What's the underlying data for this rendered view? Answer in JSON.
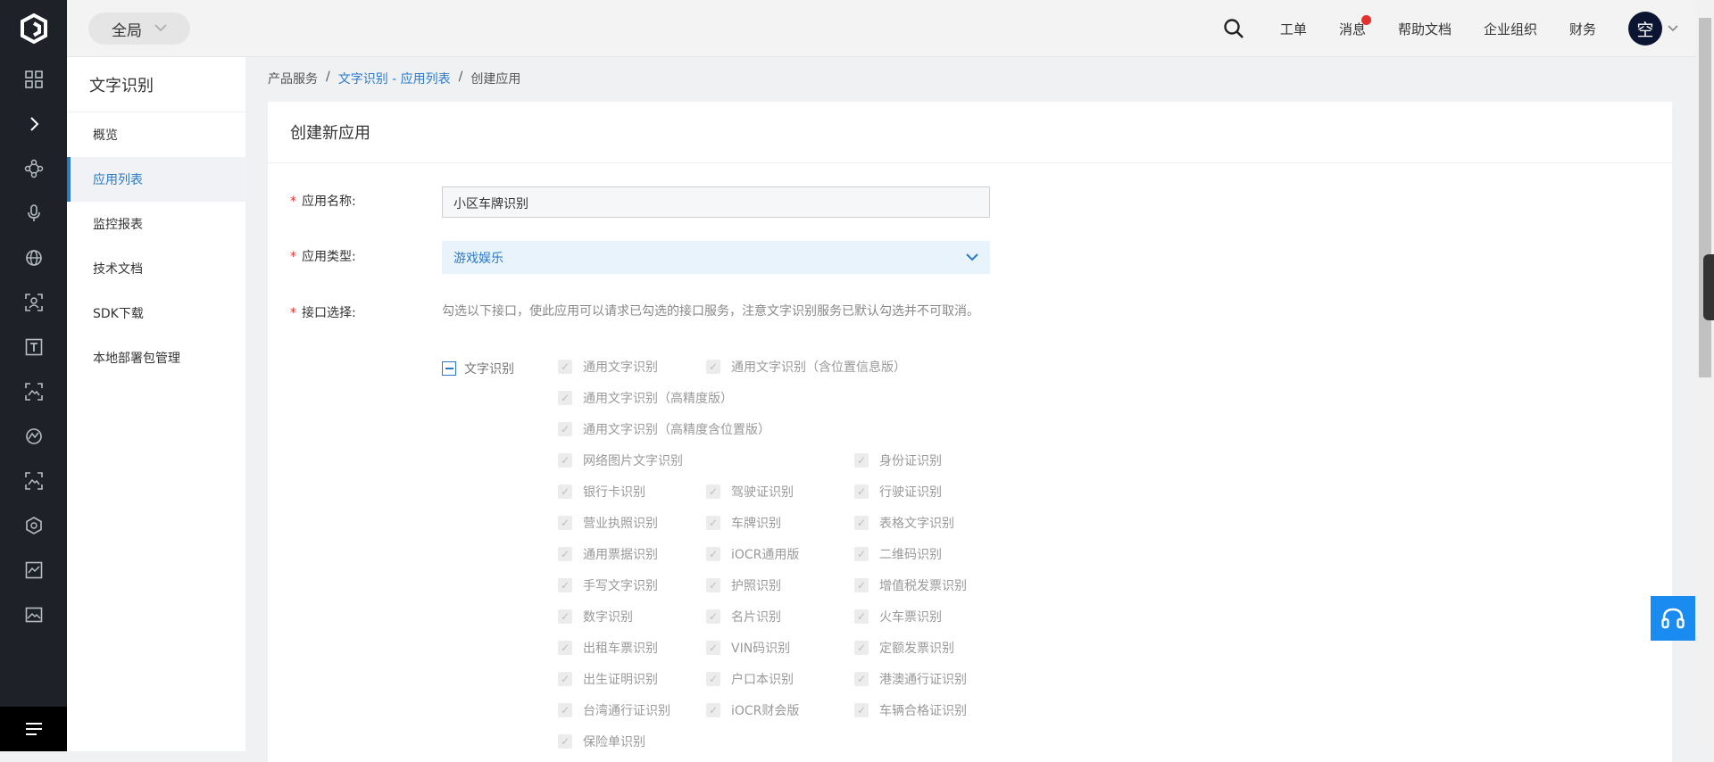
{
  "rail": {
    "icons": [
      "logo-icon",
      "grid-icon",
      "chevron-right-icon",
      "nodes-icon",
      "microphone-icon",
      "globe-icon",
      "scan-icon",
      "text-icon",
      "image-icon",
      "curve-icon",
      "image-2-icon",
      "cube-icon",
      "chart-icon",
      "picture-icon",
      "menu-icon"
    ]
  },
  "topbar": {
    "scope": "全局",
    "nav": [
      "工单",
      "消息",
      "帮助文档",
      "企业组织",
      "财务"
    ],
    "avatar": "空"
  },
  "sidebar": {
    "title": "文字识别",
    "items": [
      {
        "label": "概览"
      },
      {
        "label": "应用列表"
      },
      {
        "label": "监控报表"
      },
      {
        "label": "技术文档"
      },
      {
        "label": "SDK下载"
      },
      {
        "label": "本地部署包管理"
      }
    ]
  },
  "breadcrumb": {
    "home": "产品服务",
    "sep": "/",
    "link": "文字识别 - 应用列表",
    "current": "创建应用"
  },
  "form": {
    "title": "创建新应用",
    "name_label": "应用名称:",
    "name_value": "小区车牌识别",
    "type_label": "应用类型:",
    "type_value": "游戏娱乐",
    "api_label": "接口选择:",
    "api_desc": "勾选以下接口，使此应用可以请求已勾选的接口服务，注意文字识别服务已默认勾选并不可取消。",
    "group_label": "文字识别",
    "apis": [
      "通用文字识别",
      "通用文字识别（含位置信息版）",
      "通用文字识别（高精度版）",
      "通用文字识别（高精度含位置版）",
      "网络图片文字识别",
      "身份证识别",
      "银行卡识别",
      "驾驶证识别",
      "行驶证识别",
      "营业执照识别",
      "车牌识别",
      "表格文字识别",
      "通用票据识别",
      "iOCR通用版",
      "二维码识别",
      "手写文字识别",
      "护照识别",
      "增值税发票识别",
      "数字识别",
      "名片识别",
      "火车票识别",
      "出租车票识别",
      "VIN码识别",
      "定额发票识别",
      "出生证明识别",
      "户口本识别",
      "港澳通行证识别",
      "台湾通行证识别",
      "iOCR财会版",
      "车辆合格证识别",
      "保险单识别"
    ]
  },
  "colors": {
    "accent": "#2a7ac8",
    "rail": "#1e2128",
    "required": "#e62f2f",
    "support": "#1a8bf0"
  }
}
